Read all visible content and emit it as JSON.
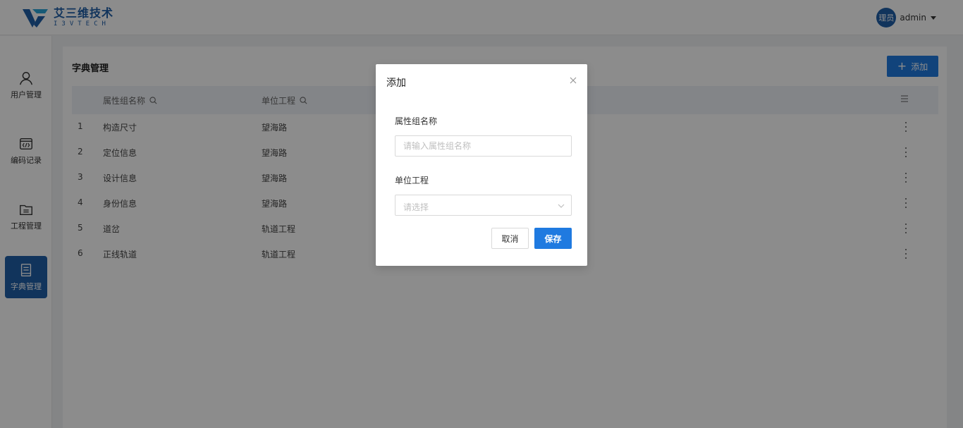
{
  "header": {
    "brand_cn": "艾三维技术",
    "brand_en": "I3VTECH",
    "avatar_text": "理员",
    "username": "admin"
  },
  "sidebar": {
    "items": [
      {
        "label": "用户管理",
        "icon": "user-icon",
        "active": false
      },
      {
        "label": "编码记录",
        "icon": "code-icon",
        "active": false
      },
      {
        "label": "工程管理",
        "icon": "folder-icon",
        "active": false
      },
      {
        "label": "字典管理",
        "icon": "book-icon",
        "active": true
      }
    ]
  },
  "main": {
    "title": "字典管理",
    "add_label": "添加",
    "columns": [
      "属性组名称",
      "单位工程"
    ],
    "rows": [
      {
        "index": "1",
        "name": "构造尺寸",
        "unit": "望海路"
      },
      {
        "index": "2",
        "name": "定位信息",
        "unit": "望海路"
      },
      {
        "index": "3",
        "name": "设计信息",
        "unit": "望海路"
      },
      {
        "index": "4",
        "name": "身份信息",
        "unit": "望海路"
      },
      {
        "index": "5",
        "name": "道岔",
        "unit": "轨道工程"
      },
      {
        "index": "6",
        "name": "正线轨道",
        "unit": "轨道工程"
      }
    ]
  },
  "modal": {
    "title": "添加",
    "field_name_label": "属性组名称",
    "field_name_placeholder": "请输入属性组名称",
    "field_unit_label": "单位工程",
    "field_unit_placeholder": "请选择",
    "cancel_label": "取消",
    "save_label": "保存"
  },
  "colors": {
    "brand": "#1f5fa8",
    "primary": "#1f7ae0",
    "table_header_bg": "#eef2f8"
  }
}
